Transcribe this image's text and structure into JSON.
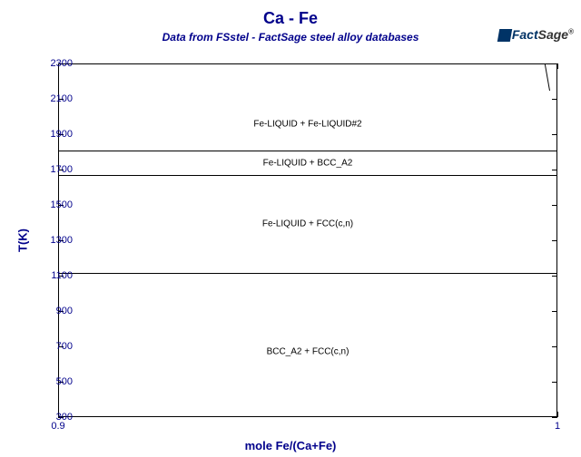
{
  "title": "Ca - Fe",
  "subtitle": "Data from FSstel - FactSage steel alloy databases",
  "logo": {
    "name_dark": "Fact",
    "name_light": "Sage",
    "reg": "®"
  },
  "xlabel": "mole Fe/(Ca+Fe)",
  "ylabel": "T(K)",
  "xticks": [
    {
      "v": 0.9,
      "label": "0.9"
    },
    {
      "v": 1.0,
      "label": "1"
    }
  ],
  "yticks": [
    {
      "v": 300,
      "label": "300"
    },
    {
      "v": 500,
      "label": "500"
    },
    {
      "v": 700,
      "label": "700"
    },
    {
      "v": 900,
      "label": "900"
    },
    {
      "v": 1100,
      "label": "1100"
    },
    {
      "v": 1300,
      "label": "1300"
    },
    {
      "v": 1500,
      "label": "1500"
    },
    {
      "v": 1700,
      "label": "1700"
    },
    {
      "v": 1900,
      "label": "1900"
    },
    {
      "v": 2100,
      "label": "2100"
    },
    {
      "v": 2300,
      "label": "2300"
    }
  ],
  "boundary_T": [
    1113,
    1667,
    1810
  ],
  "regions": [
    {
      "label": "Fe-LIQUID + Fe-LIQUID#2",
      "T_center": 1955
    },
    {
      "label": "Fe-LIQUID + BCC_A2",
      "T_center": 1738
    },
    {
      "label": "Fe-LIQUID + FCC(c,n)",
      "T_center": 1390
    },
    {
      "label": "BCC_A2 + FCC(c,n)",
      "T_center": 670
    }
  ],
  "chart_data": {
    "type": "area",
    "title": "Ca - Fe",
    "xlabel": "mole Fe/(Ca+Fe)",
    "ylabel": "T(K)",
    "xlim": [
      0.9,
      1.0
    ],
    "ylim": [
      300,
      2300
    ],
    "phase_boundaries_T": [
      1113,
      1667,
      1810
    ],
    "regions": [
      {
        "label": "Fe-LIQUID + Fe-LIQUID#2",
        "T_range": [
          1810,
          2300
        ]
      },
      {
        "label": "Fe-LIQUID + BCC_A2",
        "T_range": [
          1667,
          1810
        ]
      },
      {
        "label": "Fe-LIQUID + FCC(c,n)",
        "T_range": [
          1113,
          1667
        ]
      },
      {
        "label": "BCC_A2 + FCC(c,n)",
        "T_range": [
          300,
          1113
        ]
      }
    ],
    "liquidus_near_Fe": {
      "x": [
        0.998,
        1.0
      ],
      "T": [
        2300,
        1810
      ]
    }
  }
}
